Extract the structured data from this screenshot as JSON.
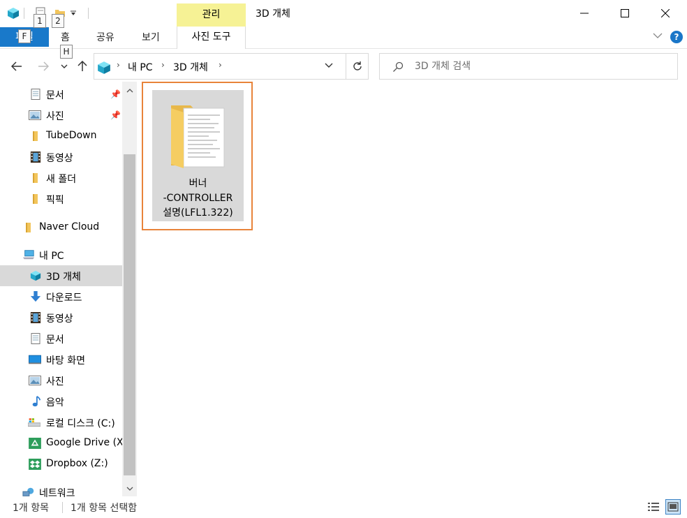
{
  "window": {
    "title": "3D 개체",
    "contextual_tab_header": "관리",
    "keytips": [
      "1",
      "2"
    ]
  },
  "ribbon": {
    "file_tab": "파일",
    "file_keytip": "F",
    "tabs": [
      "홈",
      "공유",
      "보기"
    ],
    "home_keytip": "H",
    "contextual_tab": "사진 도구"
  },
  "address": {
    "breadcrumbs": [
      "내 PC",
      "3D 개체"
    ],
    "search_placeholder": "3D 개체 검색"
  },
  "sidebar": {
    "items": [
      {
        "label": "문서",
        "icon": "document-icon",
        "pinned": true
      },
      {
        "label": "사진",
        "icon": "pictures-icon",
        "pinned": true
      },
      {
        "label": "TubeDown",
        "icon": "folder-icon"
      },
      {
        "label": "동영상",
        "icon": "video-icon"
      },
      {
        "label": "새 폴더",
        "icon": "folder-icon"
      },
      {
        "label": "픽픽",
        "icon": "folder-icon"
      },
      {
        "label": "Naver Cloud",
        "icon": "folder-icon"
      },
      {
        "label": "내 PC",
        "icon": "computer-icon"
      },
      {
        "label": "3D 개체",
        "icon": "3d-objects-icon",
        "selected": true
      },
      {
        "label": "다운로드",
        "icon": "download-icon"
      },
      {
        "label": "동영상",
        "icon": "video-icon"
      },
      {
        "label": "문서",
        "icon": "document-icon"
      },
      {
        "label": "바탕 화면",
        "icon": "desktop-icon"
      },
      {
        "label": "사진",
        "icon": "pictures-icon"
      },
      {
        "label": "음악",
        "icon": "music-icon"
      },
      {
        "label": "로컬 디스크 (C:)",
        "icon": "drive-icon"
      },
      {
        "label": "Google Drive (X",
        "icon": "google-drive-icon"
      },
      {
        "label": "Dropbox (Z:)",
        "icon": "dropbox-icon"
      },
      {
        "label": "네트워크",
        "icon": "network-icon"
      }
    ]
  },
  "content": {
    "items": [
      {
        "name": "버너\n-CONTROLLER\n설명(LFL1.322)",
        "type": "folder",
        "selected": true
      }
    ]
  },
  "status": {
    "item_count": "1개 항목",
    "selected_count": "1개 항목 선택함"
  },
  "colors": {
    "accent": "#1979ca",
    "contextual": "#f6f295",
    "selection_border": "#e8833a",
    "selected_bg": "#d9d9d9"
  }
}
